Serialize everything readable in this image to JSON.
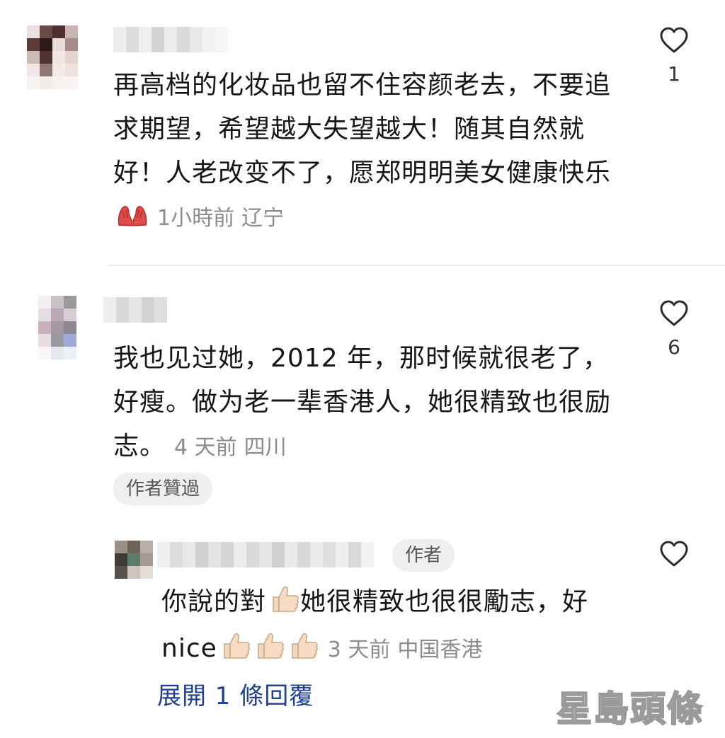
{
  "comments": [
    {
      "text": "再高档的化妆品也留不住容颜老去，不要追求期望，希望越大失望越大！随其自然就好！人老改变不了，愿郑明明美女健康快乐",
      "emoji": "palms-up-together-emoji",
      "time": "1小時前",
      "location": "辽宁",
      "likes": "1"
    },
    {
      "text": "我也见过她，2012 年，那时候就很老了，好瘦。做为老一辈香港人，她很精致也很励志。",
      "time": "4 天前",
      "location": "四川",
      "likes": "6",
      "author_liked": "作者贊過"
    }
  ],
  "reply": {
    "author_badge": "作者",
    "text_part1": "你說的對",
    "text_part2": "她很精致也很很勵志，好nice",
    "emoji": "thumbs-up-emoji",
    "time": "3 天前",
    "location": "中国香港",
    "likes": ""
  },
  "expand_replies": "展開 1 條回覆",
  "watermark": "星島頭條",
  "colors": {
    "text": "#161616",
    "meta": "#8c8c8c",
    "link": "#1f3f8f",
    "chip_bg": "#efefef"
  }
}
